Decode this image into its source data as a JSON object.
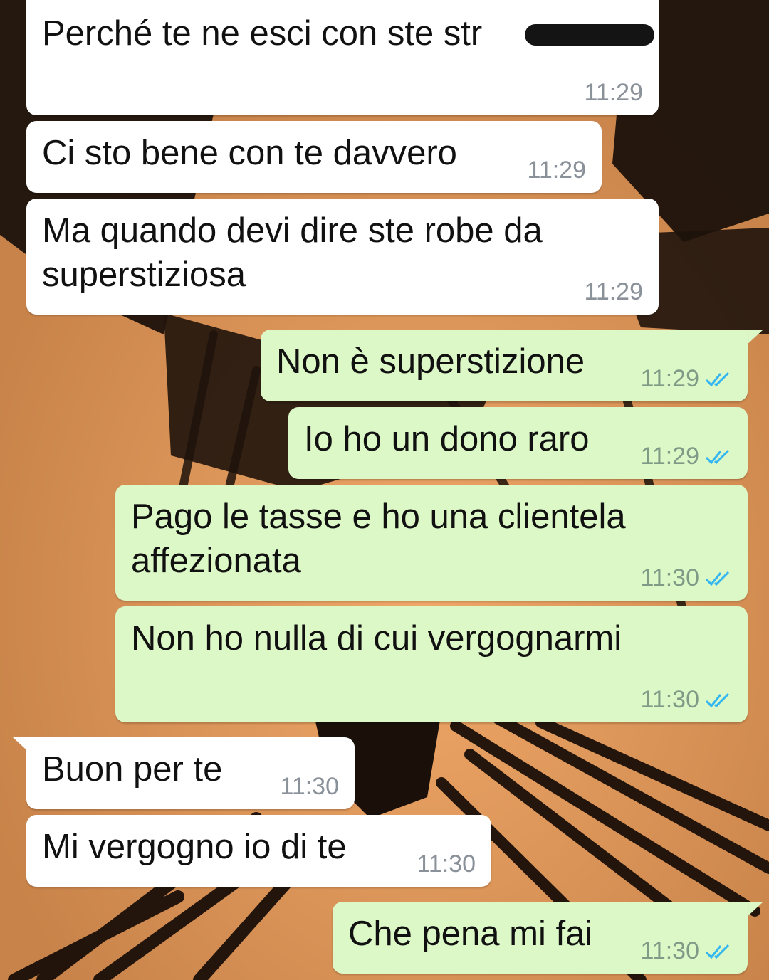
{
  "messages": [
    {
      "direction": "incoming",
      "text": "Perché te ne esci con ste str",
      "time": "11:29",
      "redacted_suffix": true
    },
    {
      "direction": "incoming",
      "text": "Ci sto bene con te davvero",
      "time": "11:29"
    },
    {
      "direction": "incoming",
      "text": "Ma quando devi dire ste robe da\nsuperstiziosa",
      "time": "11:29"
    },
    {
      "direction": "outgoing",
      "text": "Non è superstizione",
      "time": "11:29",
      "status": "read"
    },
    {
      "direction": "outgoing",
      "text": "Io ho un dono raro",
      "time": "11:29",
      "status": "read"
    },
    {
      "direction": "outgoing",
      "text": "Pago le tasse e ho una clientela\naffezionata",
      "time": "11:30",
      "status": "read"
    },
    {
      "direction": "outgoing",
      "text": "Non ho nulla di cui vergognarmi",
      "time": "11:30",
      "status": "read"
    },
    {
      "direction": "incoming",
      "text": "Buon per te",
      "time": "11:30"
    },
    {
      "direction": "incoming",
      "text": "Mi vergogno io di te",
      "time": "11:30"
    },
    {
      "direction": "outgoing",
      "text": "Che pena mi fai",
      "time": "11:30",
      "status": "read"
    }
  ],
  "colors": {
    "incoming_bubble": "#ffffff",
    "outgoing_bubble": "#dcf8c6",
    "read_ticks": "#34b7f1",
    "wallpaper": "#d9955a"
  },
  "icons": {
    "read_status": "double-check-icon"
  }
}
